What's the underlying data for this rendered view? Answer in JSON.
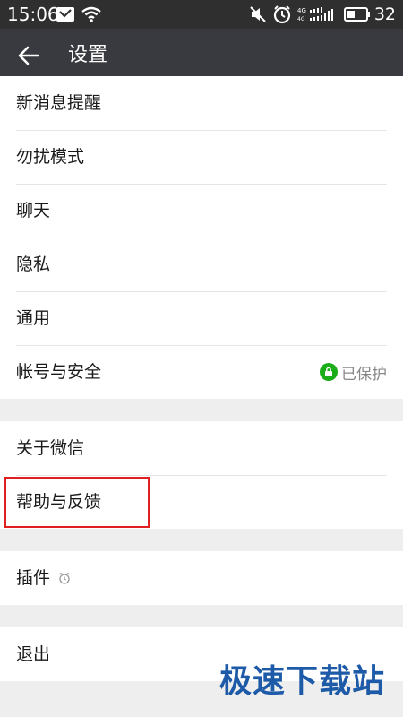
{
  "status_bar": {
    "time": "15:06",
    "battery_level": "32"
  },
  "header": {
    "back_icon": "arrow-left-icon",
    "title": "设置"
  },
  "groups": [
    {
      "items": [
        {
          "label": "新消息提醒"
        },
        {
          "label": "勿扰模式"
        },
        {
          "label": "聊天"
        },
        {
          "label": "隐私"
        },
        {
          "label": "通用"
        },
        {
          "label": "帐号与安全",
          "status": "已保护",
          "status_icon": "lock-icon",
          "status_color": "#1aad19"
        }
      ]
    },
    {
      "items": [
        {
          "label": "关于微信"
        },
        {
          "label": "帮助与反馈",
          "highlighted": true,
          "highlight_color": "#e02020"
        }
      ]
    },
    {
      "items": [
        {
          "label": "插件",
          "icon": "alarm-clock-icon"
        }
      ]
    },
    {
      "items": [
        {
          "label": "退出"
        }
      ]
    }
  ],
  "watermark": "极速下载站",
  "colors": {
    "status_bar": "#2f2f2f",
    "title_bar": "#393a3f",
    "background": "#eeeeee",
    "accent_green": "#1aad19",
    "watermark_blue": "#1d5aa8"
  }
}
